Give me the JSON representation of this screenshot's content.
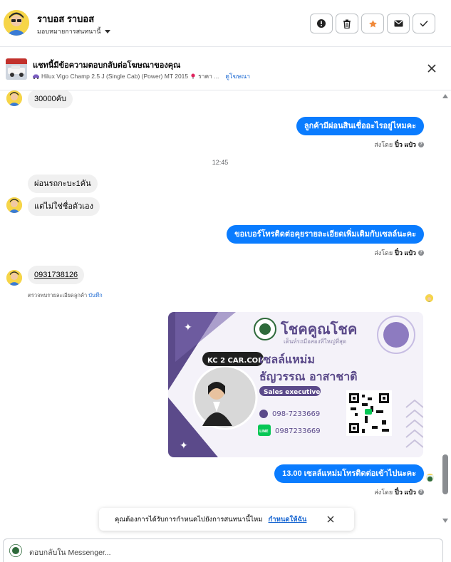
{
  "header": {
    "contact_name": "ราบอส ราบอส",
    "assign_label": "มอบหมายการสนทนานี้",
    "buttons": [
      {
        "name": "report",
        "icon": "exclamation-circle-icon"
      },
      {
        "name": "delete",
        "icon": "trash-icon"
      },
      {
        "name": "star",
        "icon": "star-icon",
        "color": "#f0893a"
      },
      {
        "name": "mark-unread",
        "icon": "envelope-icon"
      },
      {
        "name": "mark-done",
        "icon": "checkmark-icon"
      }
    ]
  },
  "ad": {
    "title": "แชทนี้มีข้อความตอบกลับต่อโฆษณาของคุณ",
    "subtitle": "Hilux Vigo Champ 2.5 J (Single Cab) (Power) MT 2015",
    "price_prefix": "ราคา ...",
    "link": "ดูโฆษณา"
  },
  "messages": {
    "m1": "30000คับ",
    "m2": "ลูกค้ามีผ่อนสินเชื่ออะไรอยู่ไหมคะ",
    "sent_prefix": "ส่งโดย",
    "sent_by": "ปิ๋ว แป๋ว",
    "time": "12:45",
    "m3": "ผ่อนรถกะบะ1คัน",
    "m4": "แต่ไม่ใช่ชื่อตัวเอง",
    "m5": "ขอเบอร์โทรติดต่อคุยรายละเอียดเพิ่มเติมกับเซลล์นะคะ",
    "m6": "0931738126",
    "note_text": "ตรวจพบรายละเอียดลูกค้า",
    "note_link": "บันทึก",
    "m7": "13.00 เซลล์แหม่มโทรติดต่อเข้าไปนะคะ"
  },
  "card": {
    "brand": "โชคคูณโชค",
    "tagline": "เต็นท์รถมือสองที่ใหญ่ที่สุด",
    "badge": "KC 2 CAR.COM",
    "nickname": "เซลล์แหม่ม",
    "full_name": "ธัญวรรณ อาสาชาติ",
    "role": "Sales executive",
    "phone": "098-7233669",
    "line_label": "LINE",
    "line_id": "0987233669",
    "accent": "#5b4a8a"
  },
  "toast": {
    "text": "คุณต้องการได้รับการกำหนดไปยังการสนทนานี้ไหม",
    "link": "กำหนดให้ฉัน"
  },
  "composer": {
    "placeholder": "ตอบกลับใน Messenger..."
  },
  "colors": {
    "outgoing": "#0a7cff",
    "incoming": "#f0f0f0",
    "link": "#1967d2"
  }
}
